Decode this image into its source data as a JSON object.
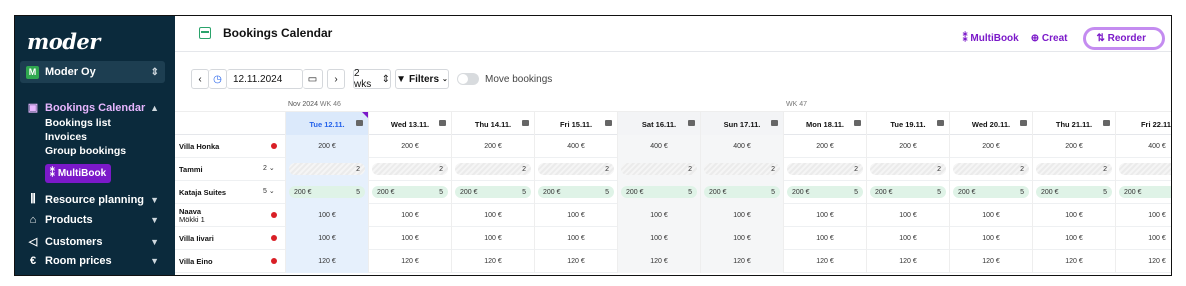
{
  "sidebar": {
    "logo": "moder",
    "company": {
      "badge": "M",
      "name": "Moder Oy"
    },
    "nav": [
      {
        "label": "Bookings Calendar",
        "icon": "calendar-icon",
        "active": true
      },
      {
        "label": "Resource planning",
        "icon": "sliders-icon"
      },
      {
        "label": "Products",
        "icon": "home-icon"
      },
      {
        "label": "Customers",
        "icon": "megaphone-icon"
      },
      {
        "label": "Room prices",
        "icon": "euro-icon"
      }
    ],
    "subitems": [
      "Bookings list",
      "Invoices",
      "Group bookings"
    ],
    "multibook": "MultiBook"
  },
  "header": {
    "title": "Bookings Calendar",
    "actions": {
      "multibook": "MultiBook",
      "create": "Creat",
      "reorder": "Reorder"
    }
  },
  "controls": {
    "date": "12.11.2024",
    "weeks": "2 wks",
    "filters": "Filters",
    "move_bookings": "Move bookings"
  },
  "calendar": {
    "week_labels": [
      {
        "month": "Nov 2024",
        "wk": "WK 46"
      },
      {
        "wk": "WK 47"
      }
    ],
    "days": [
      {
        "label": "Tue 12.11.",
        "today": true
      },
      {
        "label": "Wed 13.11."
      },
      {
        "label": "Thu 14.11."
      },
      {
        "label": "Fri 15.11."
      },
      {
        "label": "Sat 16.11.",
        "weekend": true
      },
      {
        "label": "Sun 17.11.",
        "weekend": true
      },
      {
        "label": "Mon 18.11."
      },
      {
        "label": "Tue 19.11."
      },
      {
        "label": "Wed 20.11."
      },
      {
        "label": "Thu 21.11."
      },
      {
        "label": "Fri 22.11."
      }
    ],
    "rows": [
      {
        "name": "Villa Honka",
        "type": "single",
        "values": [
          "200 €",
          "200 €",
          "200 €",
          "400 €",
          "400 €",
          "400 €",
          "200 €",
          "200 €",
          "200 €",
          "200 €",
          "400 €"
        ]
      },
      {
        "name": "Tammi",
        "type": "group",
        "count": "2",
        "pill": "hatch",
        "values": [
          "2",
          "2",
          "2",
          "2",
          "2",
          "2",
          "2",
          "2",
          "2",
          "2",
          ""
        ]
      },
      {
        "name": "Kataja Suites",
        "type": "group",
        "count": "5",
        "pill": "green",
        "price": "200 €",
        "values": [
          "5",
          "5",
          "5",
          "5",
          "5",
          "5",
          "5",
          "5",
          "5",
          "5",
          ""
        ]
      },
      {
        "name": "Naava",
        "sub": "Mökki 1",
        "type": "single",
        "values": [
          "100 €",
          "100 €",
          "100 €",
          "100 €",
          "100 €",
          "100 €",
          "100 €",
          "100 €",
          "100 €",
          "100 €",
          "100 €"
        ]
      },
      {
        "name": "Villa Iivari",
        "type": "single",
        "values": [
          "100 €",
          "100 €",
          "100 €",
          "100 €",
          "100 €",
          "100 €",
          "100 €",
          "100 €",
          "100 €",
          "100 €",
          "100 €"
        ]
      },
      {
        "name": "Villa Eino",
        "type": "single",
        "values": [
          "120 €",
          "120 €",
          "120 €",
          "120 €",
          "120 €",
          "120 €",
          "120 €",
          "120 €",
          "120 €",
          "120 €",
          "120 €"
        ]
      }
    ]
  },
  "colors": {
    "sidebar_bg": "#0b2a3c",
    "accent": "#7b19c9",
    "today": "#dbe9fb"
  }
}
